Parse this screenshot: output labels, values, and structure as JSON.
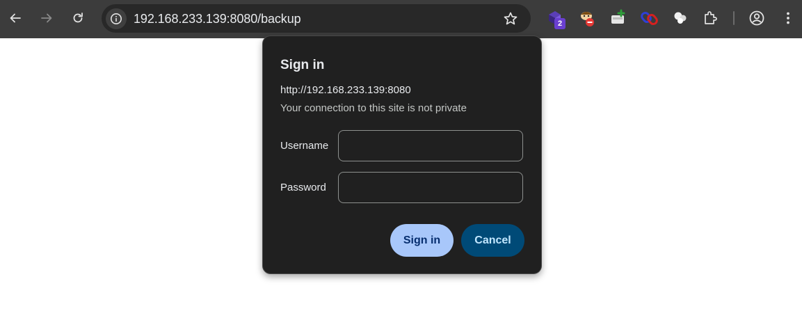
{
  "browser": {
    "url": "192.168.233.139:8080/backup",
    "extension_badge_count": "2",
    "icons": [
      "back-arrow-icon",
      "forward-arrow-icon",
      "reload-icon",
      "site-info-icon",
      "bookmark-star-icon",
      "extensions-puzzle-icon",
      "profile-icon",
      "more-menu-icon"
    ],
    "theme_color": "#3c3c3c"
  },
  "dialog": {
    "title": "Sign in",
    "origin": "http://192.168.233.139:8080",
    "warning": "Your connection to this site is not private",
    "username_label": "Username",
    "username_value": "",
    "password_label": "Password",
    "password_value": "",
    "signin_label": "Sign in",
    "cancel_label": "Cancel",
    "signin_color": "#a8c7fa",
    "cancel_color": "#004a77"
  }
}
